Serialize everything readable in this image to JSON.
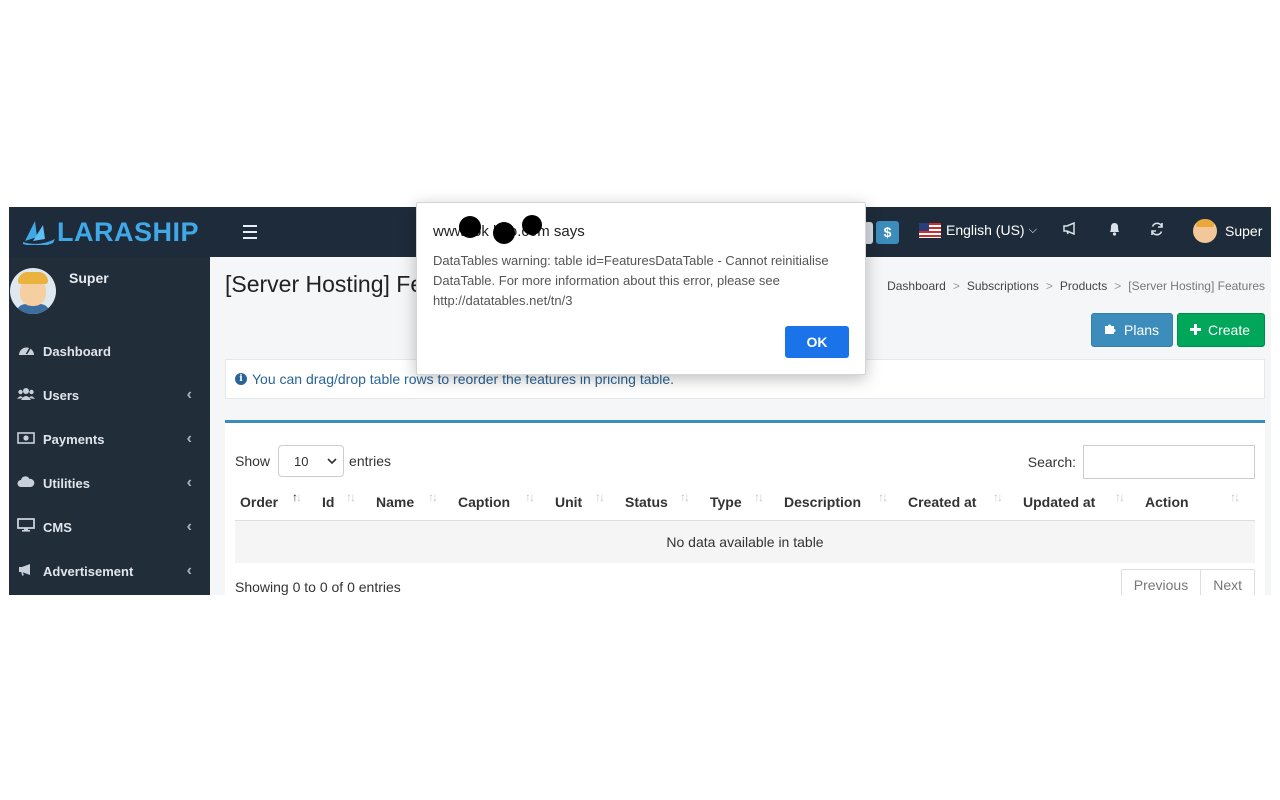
{
  "brand": {
    "name": "LARASHIP",
    "color": "#3fa9e8"
  },
  "topbar": {
    "currency_icon": "$",
    "language": "English (US)",
    "language_caret": "⌵",
    "icons": [
      "bullhorn-icon",
      "bell-icon",
      "refresh-icon"
    ],
    "user_name": "Super"
  },
  "sidebar": {
    "user_name": "Super",
    "items": [
      {
        "label": "Dashboard",
        "icon": "dashboard-icon",
        "has_children": false
      },
      {
        "label": "Users",
        "icon": "users-icon",
        "has_children": true
      },
      {
        "label": "Payments",
        "icon": "money-icon",
        "has_children": true
      },
      {
        "label": "Utilities",
        "icon": "cloud-icon",
        "has_children": true
      },
      {
        "label": "CMS",
        "icon": "desktop-icon",
        "has_children": true
      },
      {
        "label": "Advertisement",
        "icon": "bullhorn-icon",
        "has_children": true
      }
    ]
  },
  "page": {
    "title": "[Server Hosting] Features",
    "breadcrumb": [
      "Dashboard",
      "Subscriptions",
      "Products",
      "[Server Hosting] Features"
    ],
    "buttons": {
      "plans": "Plans",
      "create": "Create"
    },
    "info_message": "You can drag/drop table rows to reorder the features in pricing table."
  },
  "table": {
    "show_label": "Show",
    "entries_label": "entries",
    "page_size": "10",
    "search_label": "Search:",
    "search_value": "",
    "columns": [
      "Order",
      "Id",
      "Name",
      "Caption",
      "Unit",
      "Status",
      "Type",
      "Description",
      "Created at",
      "Updated at",
      "Action"
    ],
    "empty_message": "No data available in table",
    "info": "Showing 0 to 0 of 0 entries",
    "pagination": {
      "previous": "Previous",
      "next": "Next"
    }
  },
  "dialog": {
    "title": "www.        ok   koo.com says",
    "message": "DataTables warning: table id=FeaturesDataTable - Cannot reinitialise DataTable. For more information about this error, please see http://datatables.net/tn/3",
    "ok_label": "OK"
  },
  "colors": {
    "topbar": "#1e2b3a",
    "sidebar": "#222d3a",
    "primary": "#3c8dbc",
    "success": "#00a65a",
    "dialog_button": "#1a73e8"
  }
}
